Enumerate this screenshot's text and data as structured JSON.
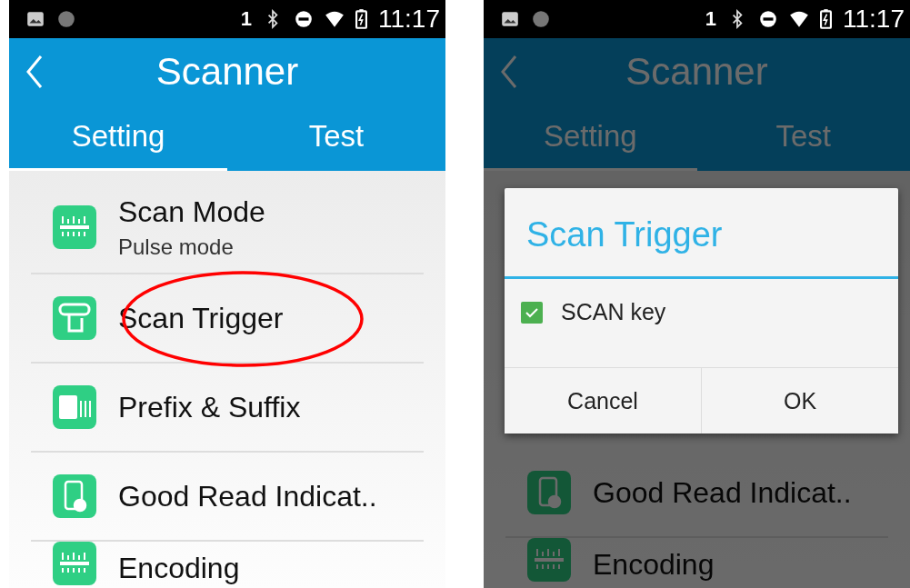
{
  "screens": [
    {
      "status_bar": {
        "notification_count": "1",
        "time": "11:17"
      },
      "app_bar": {
        "title": "Scanner"
      },
      "dimmed": false,
      "tabs": [
        {
          "label": "Setting",
          "selected": true
        },
        {
          "label": "Test",
          "selected": false
        }
      ],
      "list": [
        {
          "kind": "mode",
          "title": "Scan Mode",
          "summary": "Pulse mode",
          "circled": false
        },
        {
          "kind": "trigger",
          "title": "Scan Trigger",
          "circled": true
        },
        {
          "kind": "prefix",
          "title": "Prefix & Suffix",
          "circled": false
        },
        {
          "kind": "indicator",
          "title": "Good Read Indicat..",
          "circled": false
        },
        {
          "kind": "encoding",
          "title": "Encoding",
          "circled": false
        }
      ]
    },
    {
      "status_bar": {
        "notification_count": "1",
        "time": "11:17"
      },
      "app_bar": {
        "title": "Scanner"
      },
      "dimmed": true,
      "tabs": [
        {
          "label": "Setting",
          "selected": true
        },
        {
          "label": "Test",
          "selected": false
        }
      ],
      "list": [
        {
          "kind": "indicator",
          "title": "Good Read Indicat..",
          "circled": false
        },
        {
          "kind": "encoding",
          "title": "Encoding",
          "circled": false
        }
      ],
      "dialog": {
        "title": "Scan Trigger",
        "options": [
          {
            "label": "SCAN key",
            "checked": true
          }
        ],
        "buttons": [
          "Cancel",
          "OK"
        ]
      }
    }
  ]
}
